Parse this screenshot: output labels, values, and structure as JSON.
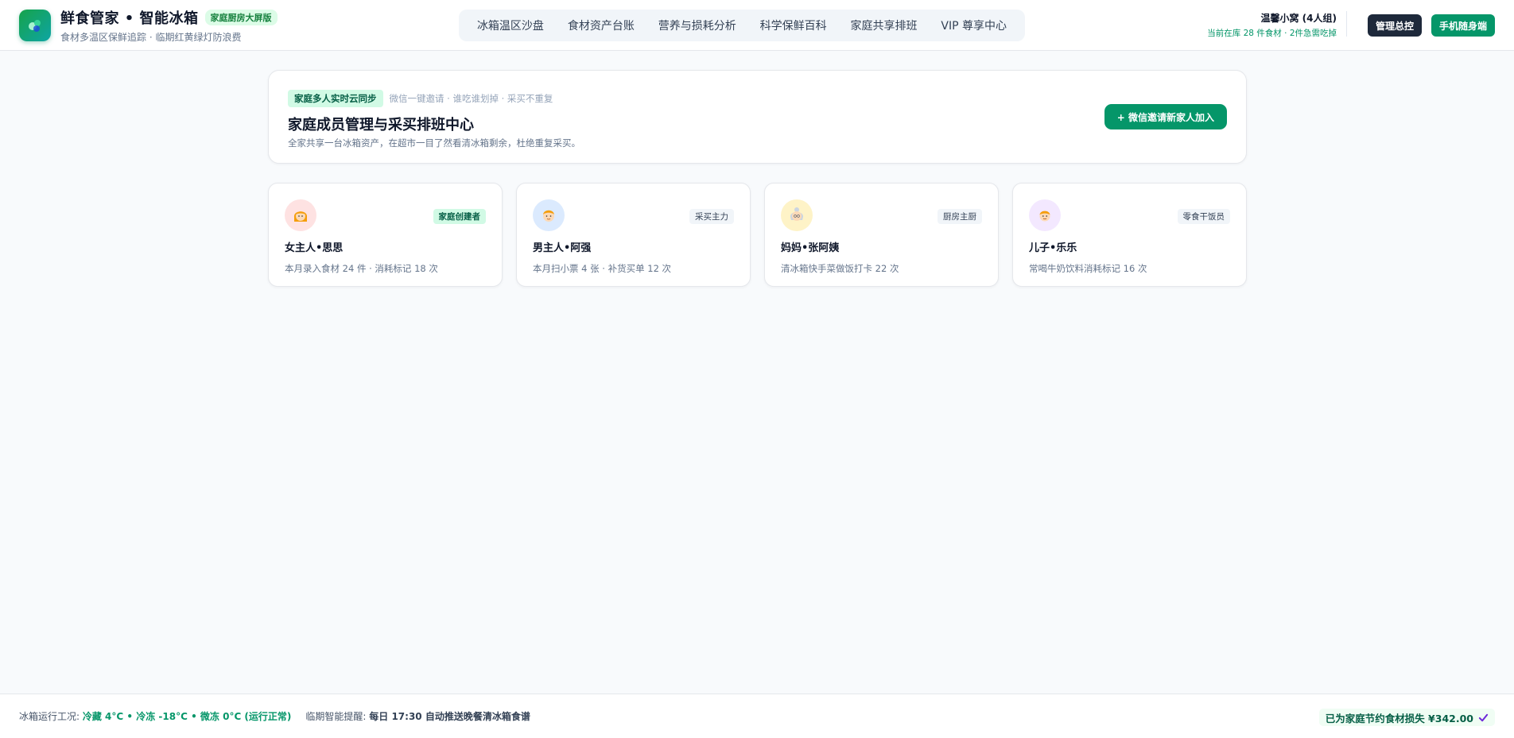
{
  "header": {
    "app_title": "鲜食管家 • 智能冰箱",
    "edition_badge": "家庭厨房大屏版",
    "subtitle": "食材多温区保鲜追踪 · 临期红黄绿灯防浪费",
    "nav": [
      {
        "label": "冰箱温区沙盘"
      },
      {
        "label": "食材资产台账"
      },
      {
        "label": "营养与损耗分析"
      },
      {
        "label": "科学保鲜百科"
      },
      {
        "label": "家庭共享排班"
      },
      {
        "label": "VIP 尊享中心"
      }
    ],
    "household_name": "温馨小窝 (4人组)",
    "household_stats": "当前在库 28 件食材 · 2件急需吃掉",
    "admin_button": "管理总控",
    "mobile_button": "手机随身端"
  },
  "hero": {
    "tag": "家庭多人实时云同步",
    "hint": "微信一键邀请 · 谁吃谁划掉 · 采买不重复",
    "title": "家庭成员管理与采买排班中心",
    "description": "全家共享一台冰箱资产，在超市一目了然看清冰箱剩余，杜绝重复采买。",
    "invite_button": "+ 微信邀请新家人加入"
  },
  "members": [
    {
      "name": "女主人•思思",
      "role": "家庭创建者",
      "stat": "本月录入食材 24 件 · 消耗标记 18 次",
      "avatar_icon": "woman-face-icon",
      "avatar_bg": "#fee2e2"
    },
    {
      "name": "男主人•阿强",
      "role": "采买主力",
      "stat": "本月扫小票 4 张 · 补货买单 12 次",
      "avatar_icon": "man-face-icon",
      "avatar_bg": "#dbeafe"
    },
    {
      "name": "妈妈•张阿姨",
      "role": "厨房主厨",
      "stat": "清冰箱快手菜做饭打卡 22 次",
      "avatar_icon": "grandma-face-icon",
      "avatar_bg": "#fef3c7"
    },
    {
      "name": "儿子•乐乐",
      "role": "零食干饭员",
      "stat": "常喝牛奶饮料消耗标记 16 次",
      "avatar_icon": "boy-face-icon",
      "avatar_bg": "#f3e8ff"
    }
  ],
  "footer": {
    "status_label": "冰箱运行工况:",
    "status_value": "冷藏 4°C • 冷冻 -18°C • 微冻 0°C (运行正常)",
    "reminder_label": "临期智能提醒:",
    "reminder_value": "每日 17:30 自动推送晚餐清冰箱食谱",
    "saving": "已为家庭节约食材损失 ¥342.00"
  },
  "colors": {
    "accent": "#059669",
    "dark": "#1e293b",
    "background": "#f8fafc"
  }
}
